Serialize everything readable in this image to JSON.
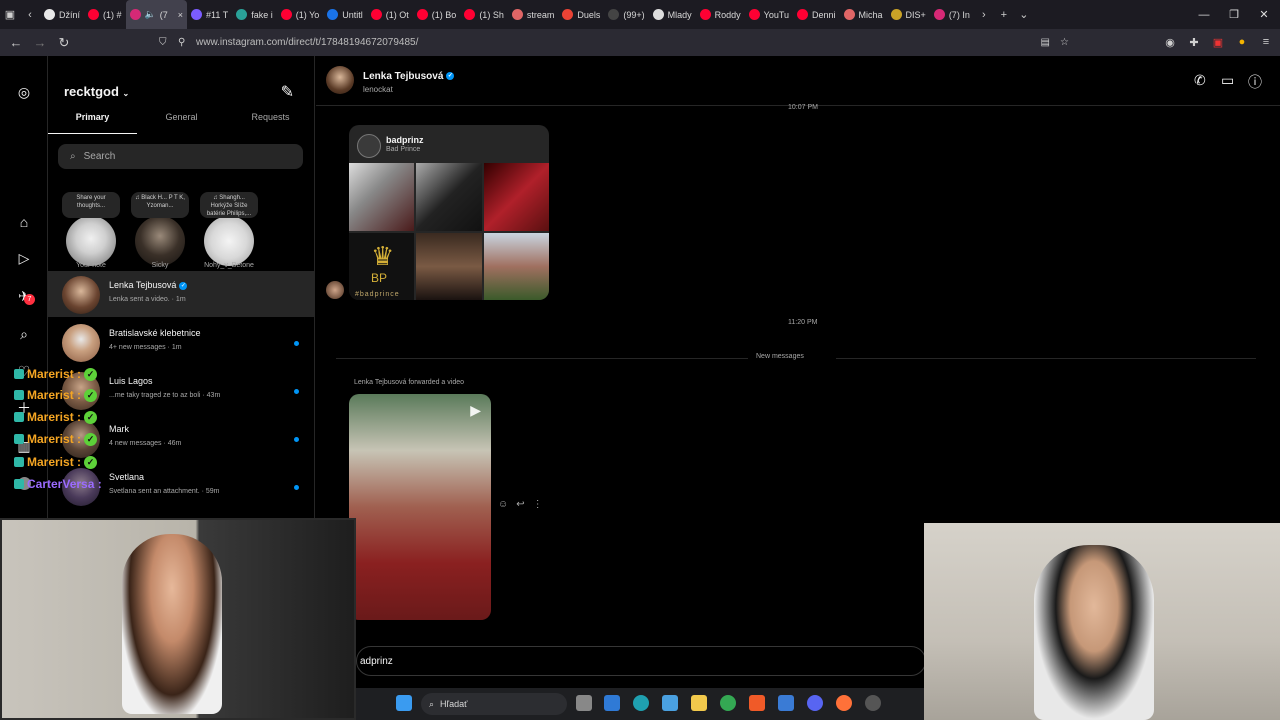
{
  "browser": {
    "tabs": [
      {
        "label": "Džíní",
        "color": "#e8e8e8"
      },
      {
        "label": "(1) #",
        "color": "#ff0033"
      },
      {
        "label": "(7",
        "color": "#d62976"
      },
      {
        "label": "#11 T",
        "color": "#7b5cff"
      },
      {
        "label": "fake i",
        "color": "#2aa198"
      },
      {
        "label": "(1) Yo",
        "color": "#ff0033"
      },
      {
        "label": "Untitl",
        "color": "#1a73e8"
      },
      {
        "label": "(1) Ot",
        "color": "#ff0033"
      },
      {
        "label": "(1) Bo",
        "color": "#ff0033"
      },
      {
        "label": "(1) Sh",
        "color": "#ff0033"
      },
      {
        "label": "stream",
        "color": "#e06666"
      },
      {
        "label": "Duels",
        "color": "#ea4335"
      },
      {
        "label": "(99+)",
        "color": "#111111"
      },
      {
        "label": "Mlady",
        "color": "#dddddd"
      },
      {
        "label": "Roddy",
        "color": "#ff0033"
      },
      {
        "label": "YouTu",
        "color": "#ff0033"
      },
      {
        "label": "Denni",
        "color": "#ff0033"
      },
      {
        "label": "Micha",
        "color": "#e06666"
      },
      {
        "label": "DIS+",
        "color": "#c9a227"
      },
      {
        "label": "(7) In",
        "color": "#d62976"
      }
    ],
    "url": "www.instagram.com/direct/t/17848194672079485/"
  },
  "sidebar_badge": "7",
  "inbox": {
    "username": "recktgod",
    "tabs": [
      "Primary",
      "General",
      "Requests"
    ],
    "search_placeholder": "Search",
    "notes": [
      {
        "bubble": "Share your thoughts...",
        "label": "Your note"
      },
      {
        "bubble": "♫ Black H... P T K, Yzoman...",
        "label": "Sicky"
      },
      {
        "bubble": "♫ Shangh... Horkýže Slíže batérie Philips,...",
        "label": "Nohy_v_Betone"
      }
    ],
    "conversations": [
      {
        "name": "Lenka Tejbusová",
        "sub": "Lenka sent a video. · 1m"
      },
      {
        "name": "Bratislavské klebetnice",
        "sub": "4+ new messages · 1m"
      },
      {
        "name": "Luis Lagos",
        "sub": "...me taky traged ze to az boli · 43m"
      },
      {
        "name": "Mark",
        "sub": "4 new messages · 46m"
      },
      {
        "name": "Svetlana",
        "sub": "Svetlana sent an attachment. · 59m"
      }
    ]
  },
  "overlay_chat": {
    "rows": [
      "Marerist :",
      "Marerist :",
      "Marerist :",
      "Marerist :",
      "Marerist :",
      "CarterVersa :"
    ]
  },
  "thread": {
    "name": "Lenka Tejbusová",
    "handle": "lenockat",
    "top_time": "10:07 PM",
    "shared_profile": {
      "username": "badprinz",
      "fullname": "Bad Prince",
      "tag": "#badprince"
    },
    "time": "11:20 PM",
    "new_messages": "New messages",
    "forwarded": "Lenka Tejbusová forwarded a video",
    "composer": "adprinz"
  },
  "taskbar": {
    "search_placeholder": "Hľadať"
  }
}
